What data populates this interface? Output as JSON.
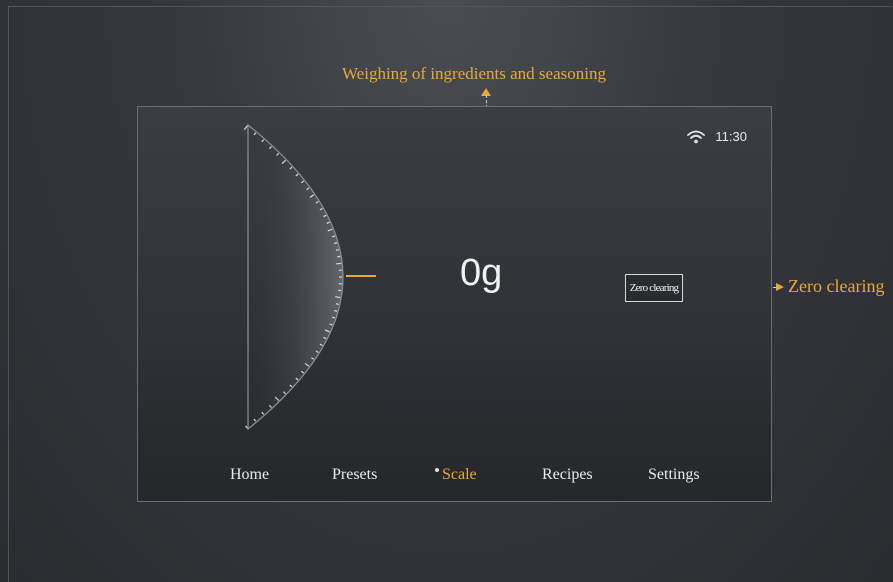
{
  "annotations": {
    "weighing": "Weighing of ingredients and seasoning",
    "zero": "Zero clearing"
  },
  "status": {
    "wifi_icon": "wifi-icon",
    "time": "11:30"
  },
  "scale": {
    "weight": "0g",
    "zero_button": "Zero clearing"
  },
  "nav": {
    "items": [
      {
        "label": "Home"
      },
      {
        "label": "Presets"
      },
      {
        "label": "Scale",
        "active": true
      },
      {
        "label": "Recipes"
      },
      {
        "label": "Settings"
      }
    ]
  },
  "colors": {
    "accent": "#e8a83a",
    "background": "#2f3236"
  }
}
